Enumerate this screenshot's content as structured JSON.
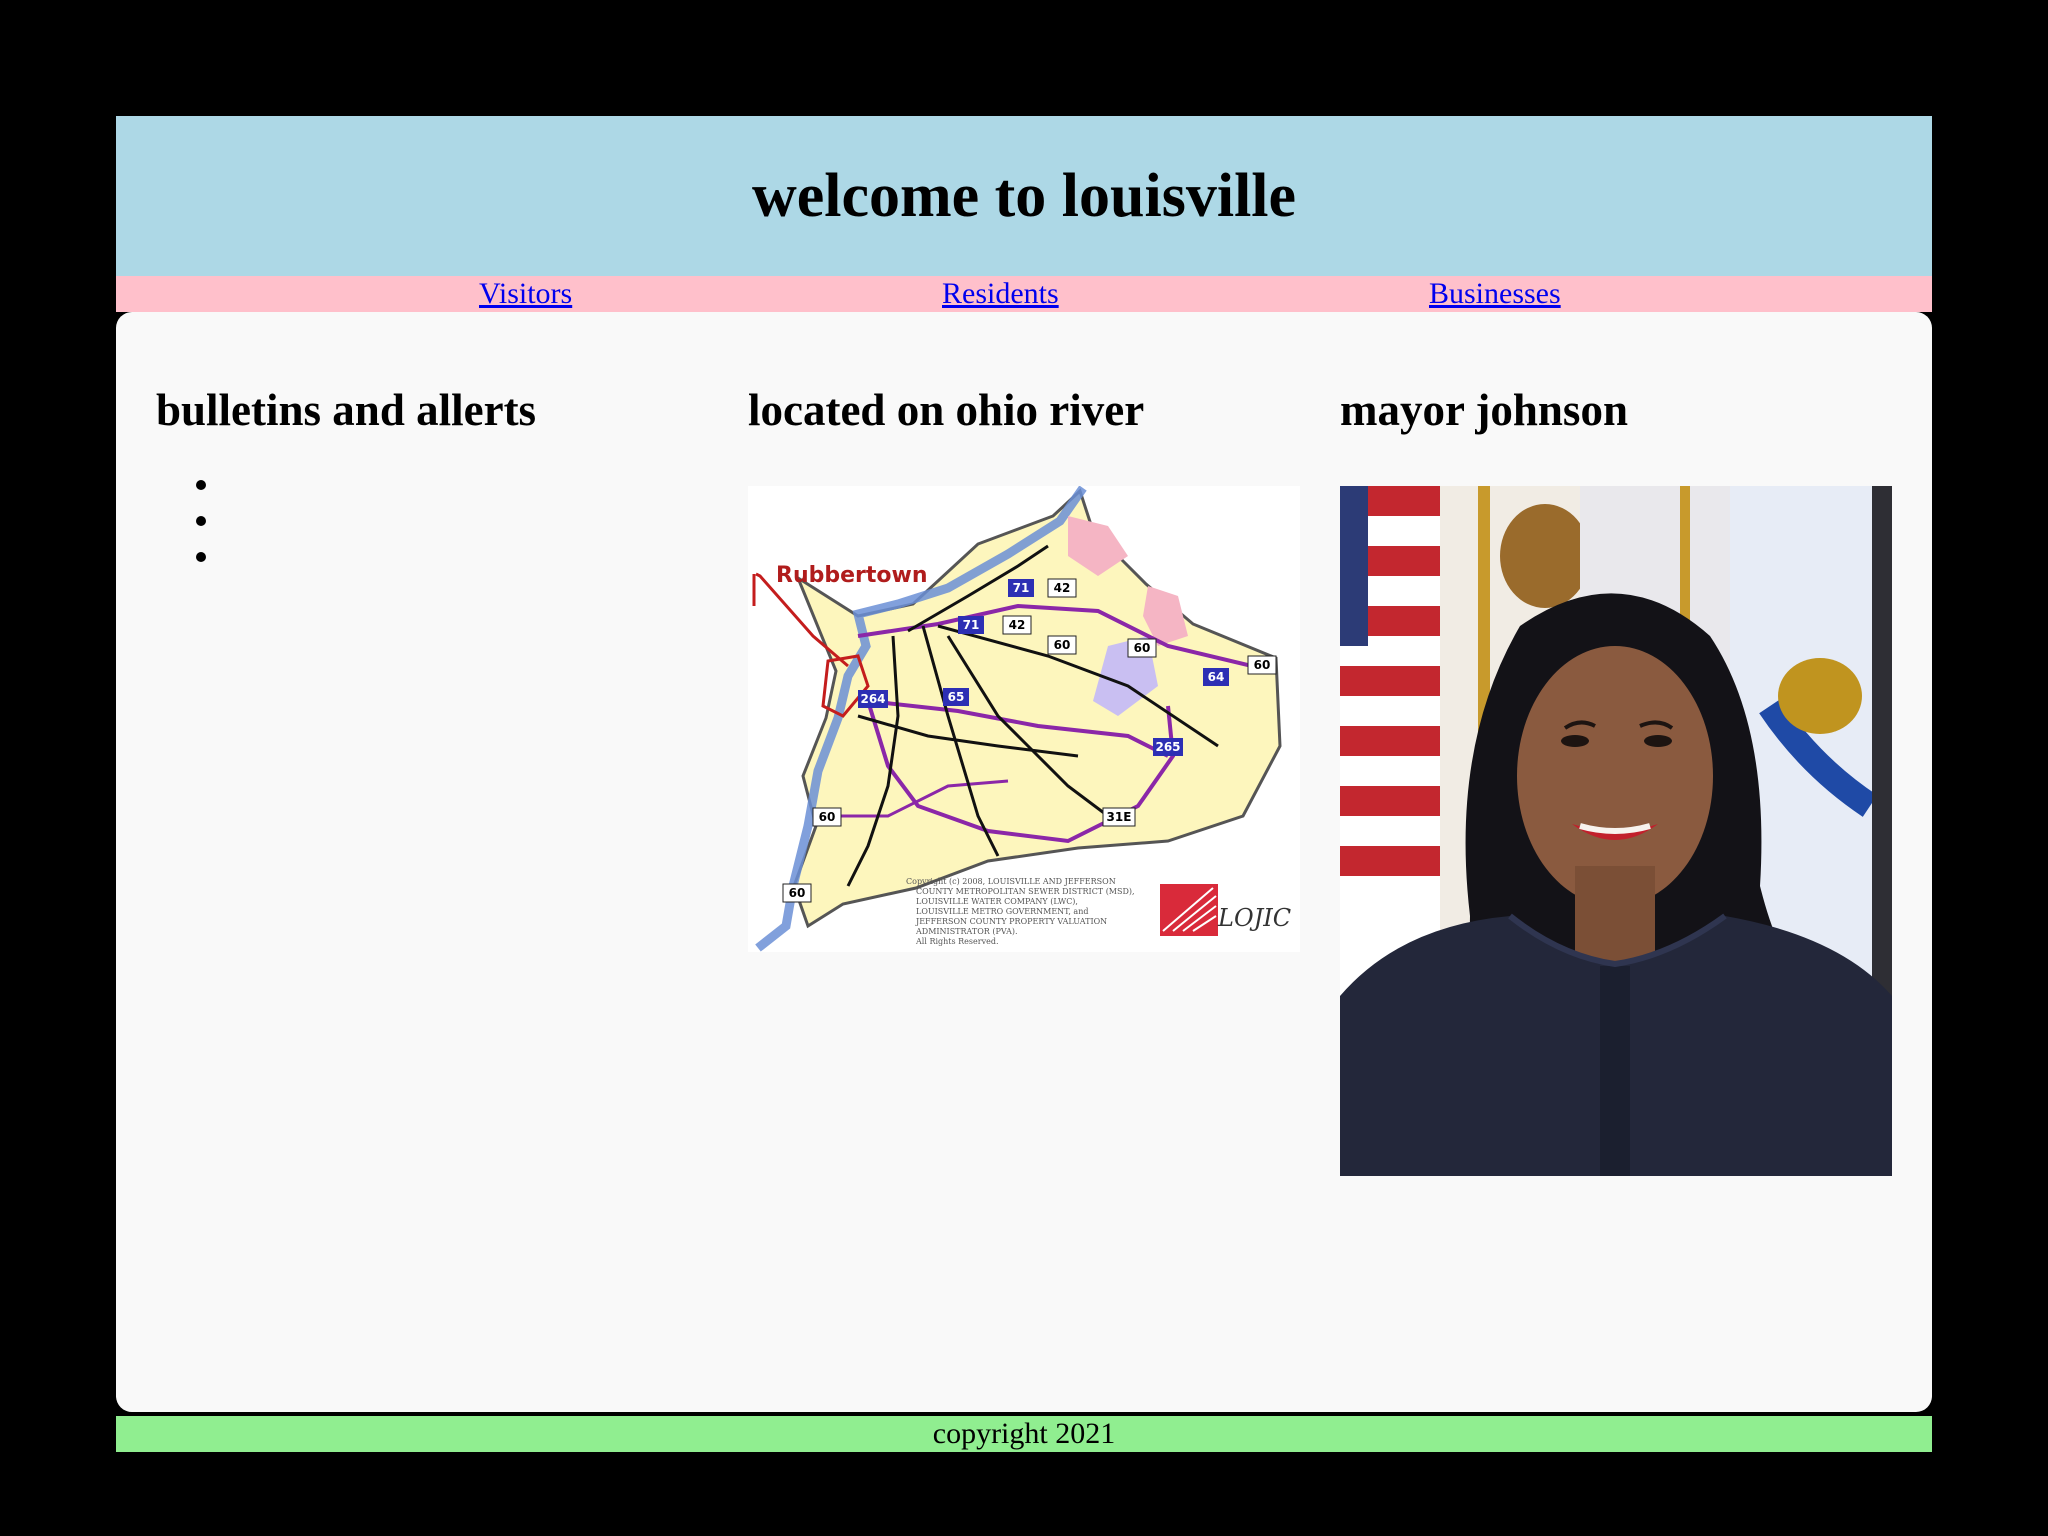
{
  "header": {
    "title": "welcome to louisville"
  },
  "nav": {
    "links": [
      "Visitors",
      "Residents",
      "Businesses"
    ]
  },
  "columns": [
    {
      "heading": "bulletins and allerts",
      "bullet_count": 3
    },
    {
      "heading": "located on ohio river"
    },
    {
      "heading": "mayor johnson"
    }
  ],
  "map": {
    "callout": "Rubbertown",
    "route_shields": [
      "71",
      "42",
      "42",
      "71",
      "60",
      "60",
      "64",
      "60",
      "264",
      "65",
      "265",
      "60",
      "31E",
      "60"
    ],
    "logo_text": "LOJIC",
    "copyright_lines": [
      "Copyright (c) 2008, LOUISVILLE AND JEFFERSON",
      "COUNTY METROPOLITAN SEWER DISTRICT (MSD),",
      "LOUISVILLE WATER COMPANY (LWC),",
      "LOUISVILLE METRO GOVERNMENT, and",
      "JEFFERSON COUNTY PROPERTY VALUATION",
      "ADMINISTRATOR (PVA).",
      "All Rights Reserved."
    ]
  },
  "footer": {
    "text": "copyright 2021"
  },
  "colors": {
    "header_bg": "#add8e6",
    "nav_bg": "#ffc0cb",
    "footer_bg": "#90ee90",
    "main_bg": "#f9f9f9",
    "link": "#0000ee"
  }
}
